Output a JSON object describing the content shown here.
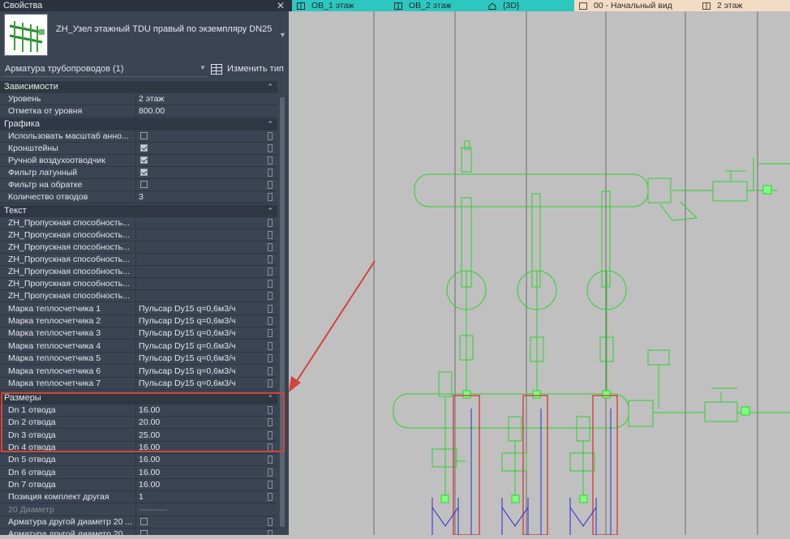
{
  "panel": {
    "title": "Свойства",
    "type_name": "ZH_Узел этажный TDU правый по экземпляру DN25",
    "family_select": "Арматура трубопроводов (1)",
    "edit_type_label": "Изменить тип"
  },
  "groups": [
    {
      "title": "Зависимости"
    },
    {
      "title": "Графика"
    },
    {
      "title": "Текст"
    },
    {
      "title": "Размеры"
    }
  ],
  "rows": {
    "level": {
      "label": "Уровень",
      "value": "2 этаж"
    },
    "offset": {
      "label": "Отметка от уровня",
      "value": "800.00"
    },
    "g1": {
      "label": "Использовать масштаб анно..."
    },
    "g2": {
      "label": "Кронштейны"
    },
    "g3": {
      "label": "Ручной воздухоотводчик"
    },
    "g4": {
      "label": "Фильтр латунный"
    },
    "g5": {
      "label": "Фильтр на обратке"
    },
    "g6": {
      "label": "Количество отводов",
      "value": "3"
    },
    "t1": {
      "label": "ZH_Пропускная способность..."
    },
    "t2": {
      "label": "ZH_Пропускная способность..."
    },
    "t3": {
      "label": "ZH_Пропускная способность..."
    },
    "t4": {
      "label": "ZH_Пропускная способность..."
    },
    "t5": {
      "label": "ZH_Пропускная способность..."
    },
    "t6": {
      "label": "ZH_Пропускная способность..."
    },
    "t7": {
      "label": "ZH_Пропускная способность..."
    },
    "m1": {
      "label": "Марка теплосчетчика 1",
      "value": "Пульсар Dy15 q=0,6м3/ч"
    },
    "m2": {
      "label": "Марка теплосчетчика 2",
      "value": "Пульсар Dy15 q=0,6м3/ч"
    },
    "m3": {
      "label": "Марка теплосчетчика 3",
      "value": "Пульсар Dy15 q=0,6м3/ч"
    },
    "m4": {
      "label": "Марка теплосчетчика 4",
      "value": "Пульсар Dy15 q=0,6м3/ч"
    },
    "m5": {
      "label": "Марка теплосчетчика 5",
      "value": "Пульсар Dy15 q=0,6м3/ч"
    },
    "m6": {
      "label": "Марка теплосчетчика 6",
      "value": "Пульсар Dy15 q=0,6м3/ч"
    },
    "m7": {
      "label": "Марка теплосчетчика 7",
      "value": "Пульсар Dy15 q=0,6м3/ч"
    },
    "d1": {
      "label": "Dn 1 отвода",
      "value": "16.00"
    },
    "d2": {
      "label": "Dn 2 отвода",
      "value": "20.00"
    },
    "d3": {
      "label": "Dn 3 отвода",
      "value": "25.00"
    },
    "d4": {
      "label": "Dn 4 отвода",
      "value": "16.00"
    },
    "d5": {
      "label": "Dn 5 отвода",
      "value": "16.00"
    },
    "d6": {
      "label": "Dn 6 отвода",
      "value": "16.00"
    },
    "d7": {
      "label": "Dn 7 отвода",
      "value": "16.00"
    },
    "pos": {
      "label": "Позиция комплект другая",
      "value": "1"
    },
    "diam20": {
      "label": "20 Диаметр",
      "value": "----------"
    },
    "arm1": {
      "label": "Арматура другой диаметр 20 ..."
    },
    "arm2": {
      "label": "Арматура другой диаметр 20 ..."
    }
  },
  "checks": {
    "g1": false,
    "g2": true,
    "g3": true,
    "g4": true,
    "g5": false,
    "arm1": false,
    "arm2": false
  },
  "view_tabs": [
    {
      "label": "ОВ_1 этаж",
      "bg": "#2ec7c0"
    },
    {
      "label": "ОВ_2 этаж",
      "bg": "#2ec7c0"
    },
    {
      "label": "{3D}",
      "bg": "#2ec7c0"
    },
    {
      "label": "00 - Начальный вид",
      "bg": "#f3dcc4"
    },
    {
      "label": "2 этаж",
      "bg": "#f3dcc4"
    }
  ],
  "colors": {
    "annotation": "#d2453a",
    "pipe": "#2fd12f",
    "supply": "#d43232",
    "return": "#2b2bd0"
  }
}
